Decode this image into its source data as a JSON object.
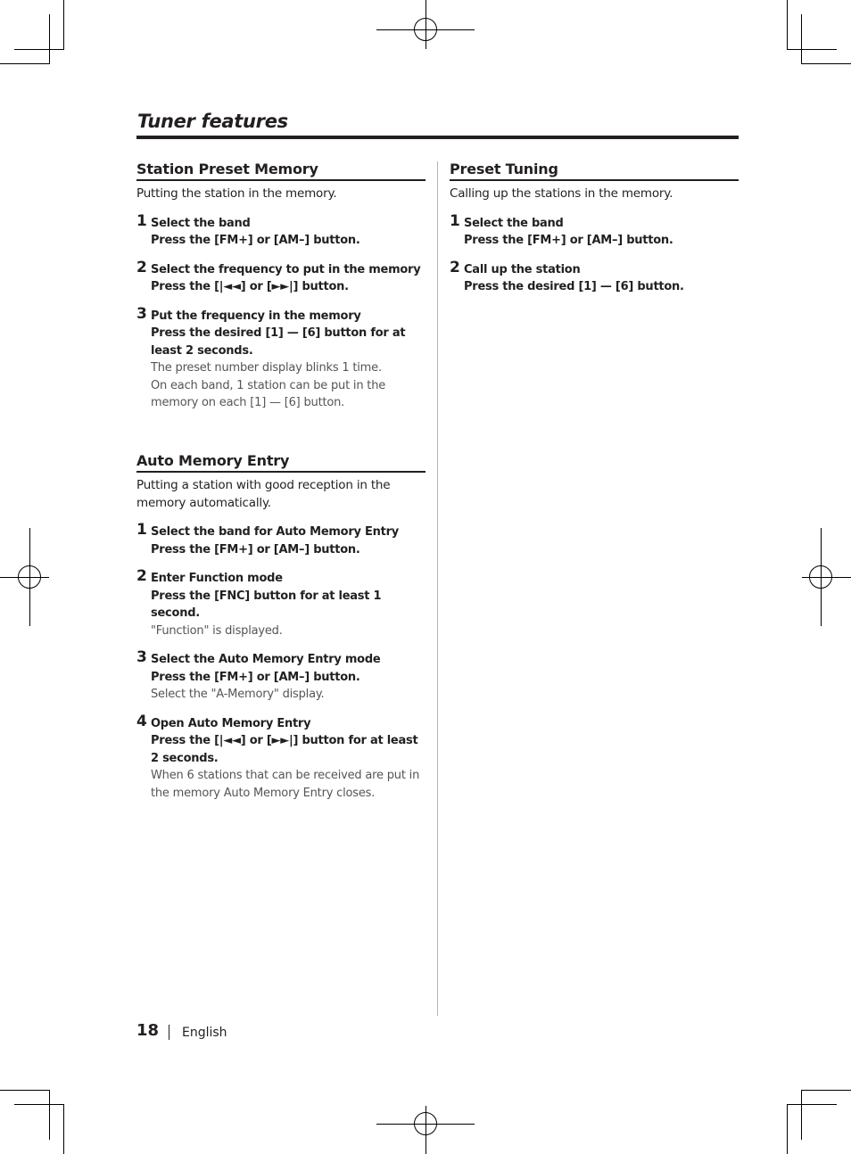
{
  "page": {
    "title": "Tuner features",
    "footer": {
      "page_number": "18",
      "language": "English"
    }
  },
  "sections": {
    "station_preset": {
      "heading": "Station Preset Memory",
      "intro": "Putting the station in the memory.",
      "steps": [
        {
          "num": "1",
          "head": "Select the band",
          "action": "Press the [FM+] or [AM–] button.",
          "notes": []
        },
        {
          "num": "2",
          "head": "Select the frequency to put in the memory",
          "action": "Press the [|◄◄] or [►►|] button.",
          "notes": []
        },
        {
          "num": "3",
          "head": "Put the frequency in the memory",
          "action": "Press the desired [1] — [6] button for at least 2 seconds.",
          "notes": [
            "The preset number display blinks 1 time.",
            "On each band, 1 station can be put in the memory on each [1] — [6] button."
          ]
        }
      ]
    },
    "auto_memory": {
      "heading": "Auto Memory Entry",
      "intro": "Putting a station with good reception in the memory automatically.",
      "steps": [
        {
          "num": "1",
          "head": "Select the band for Auto Memory Entry",
          "action": "Press the [FM+] or [AM–] button.",
          "notes": []
        },
        {
          "num": "2",
          "head": "Enter Function mode",
          "action": "Press the [FNC] button for at least 1 second.",
          "notes": [
            "\"Function\" is displayed."
          ]
        },
        {
          "num": "3",
          "head": "Select the Auto Memory Entry mode",
          "action": "Press the [FM+] or [AM–] button.",
          "notes": [
            "Select the \"A-Memory\" display."
          ]
        },
        {
          "num": "4",
          "head": "Open Auto Memory Entry",
          "action": "Press the [|◄◄] or [►►|] button for at least 2 seconds.",
          "notes": [
            "When 6 stations that can be received are put in the memory Auto Memory Entry closes."
          ]
        }
      ]
    },
    "preset_tuning": {
      "heading": "Preset Tuning",
      "intro": "Calling up the stations in the memory.",
      "steps": [
        {
          "num": "1",
          "head": "Select the band",
          "action": "Press the [FM+] or [AM–] button.",
          "notes": []
        },
        {
          "num": "2",
          "head": "Call up the station",
          "action": "Press the desired [1] — [6] button.",
          "notes": []
        }
      ]
    }
  }
}
